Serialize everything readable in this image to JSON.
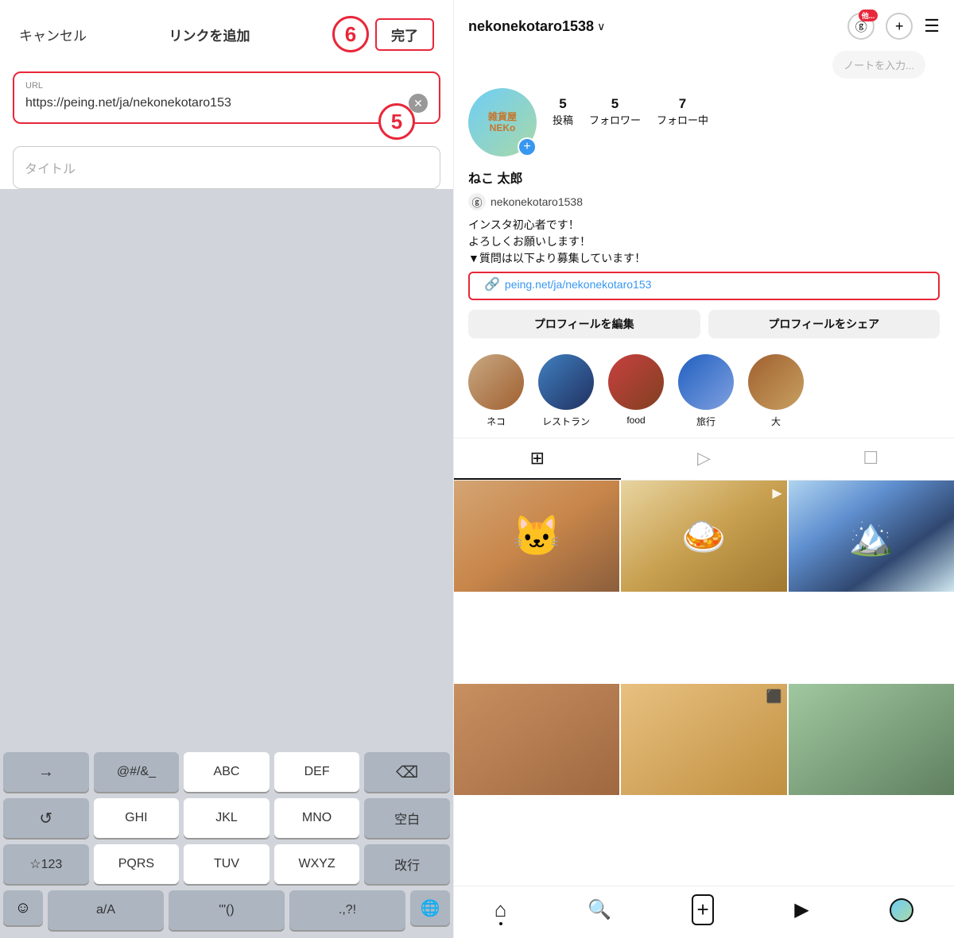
{
  "left": {
    "cancel_label": "キャンセル",
    "header_title": "リンクを追加",
    "step6_label": "6",
    "done_label": "完了",
    "url_label": "URL",
    "url_value": "https://peing.net/ja/nekonekotaro153",
    "step5_label": "5",
    "title_placeholder": "タイトル",
    "keyboard": {
      "row1": [
        "→",
        "@#/&_",
        "ABC",
        "DEF",
        "⌫"
      ],
      "row2": [
        "↺",
        "GHI",
        "JKL",
        "MNO",
        "空白"
      ],
      "row3": [
        "☆123",
        "PQRS",
        "TUV",
        "WXYZ",
        "改行"
      ],
      "row4_emoji": "☺",
      "row4_aA": "a/A",
      "row4_quotes": "'\"()",
      "row4_punct": ".,?!",
      "globe": "🌐"
    }
  },
  "right": {
    "username": "nekonekotaro1538",
    "note_placeholder": "ノートを入力...",
    "other_badge": "他...",
    "stats": {
      "posts_count": "5",
      "posts_label": "投稿",
      "followers_count": "5",
      "followers_label": "フォロワー",
      "following_count": "7",
      "following_label": "フォロー中"
    },
    "display_name": "ねこ 太郎",
    "threads_handle": "nekonekotaro1538",
    "bio_line1": "インスタ初心者です！",
    "bio_line2": "よろしくお願いします！",
    "bio_line3": "▼質問は以下より募集しています！",
    "link_url": "peing.net/ja/nekonekotaro153",
    "btn_edit": "プロフィールを編集",
    "btn_share": "プロフィールをシェア",
    "highlights": [
      {
        "label": "ネコ"
      },
      {
        "label": "レストラン"
      },
      {
        "label": "food"
      },
      {
        "label": "旅行"
      },
      {
        "label": "大"
      }
    ],
    "tabs": [
      "grid",
      "reels",
      "tagged"
    ],
    "nav": [
      "home",
      "search",
      "add",
      "reels",
      "profile"
    ]
  }
}
